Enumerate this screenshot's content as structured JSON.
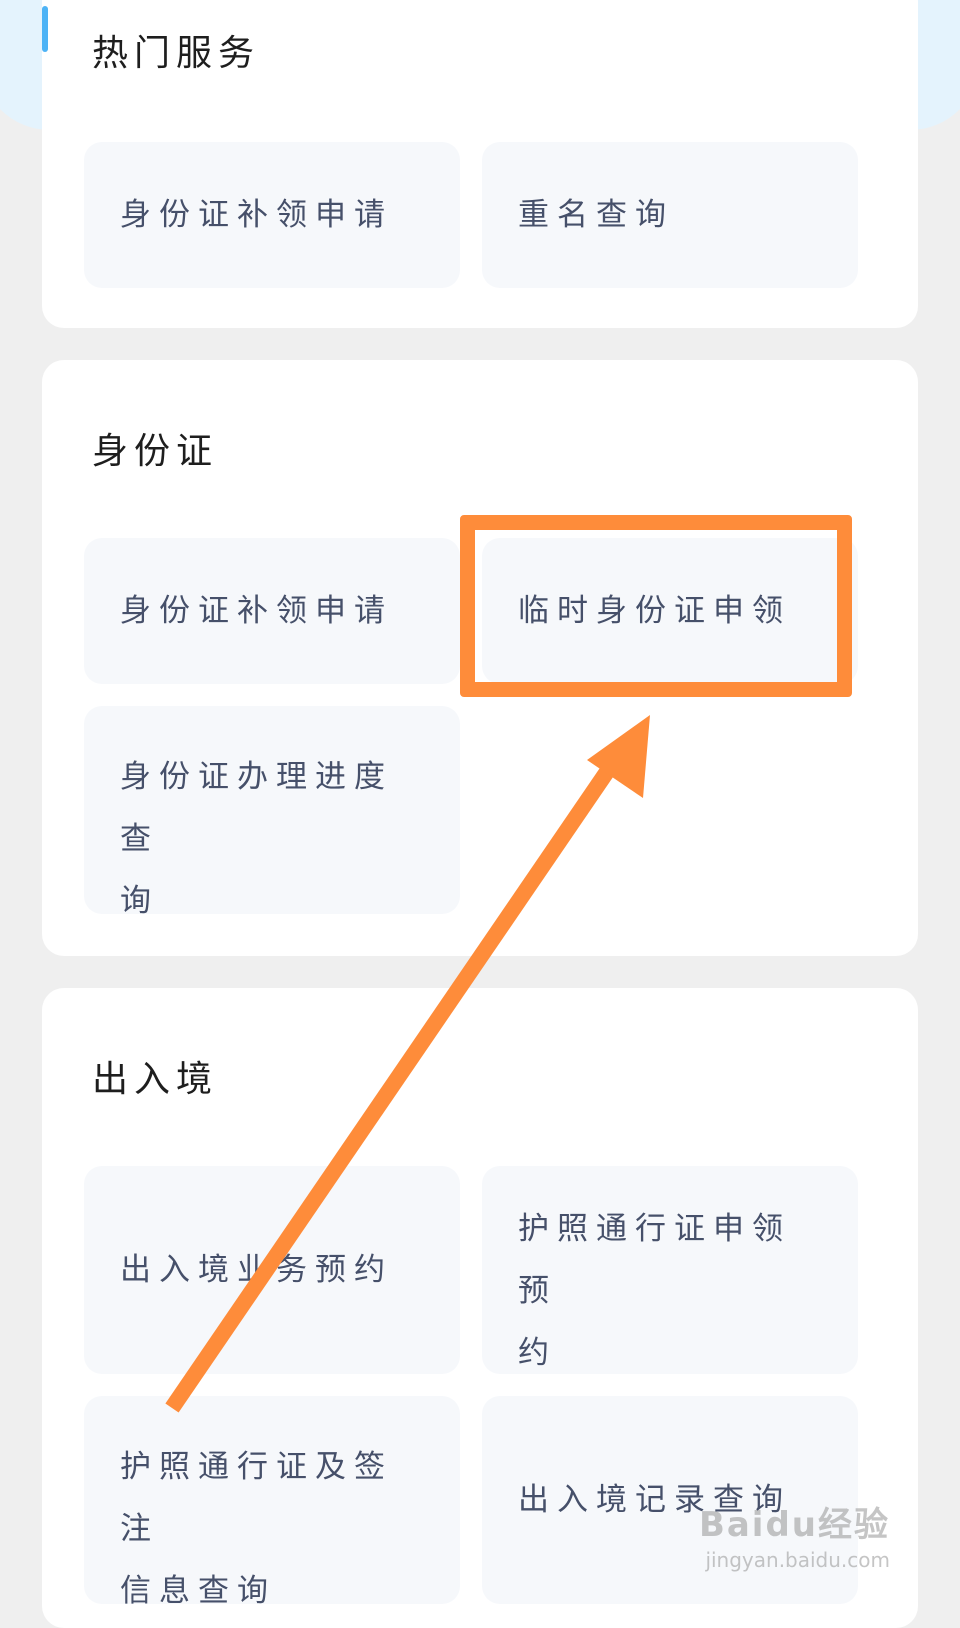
{
  "hot_services": {
    "title": "热门服务",
    "items": [
      {
        "label": "身份证补领申请"
      },
      {
        "label": "重名查询"
      }
    ]
  },
  "id_card": {
    "title": "身份证",
    "items": [
      {
        "label": "身份证补领申请"
      },
      {
        "label": "临时身份证申领"
      },
      {
        "line1": "身份证办理进度查",
        "line2": "询"
      }
    ]
  },
  "exit_entry": {
    "title": "出入境",
    "items": [
      {
        "label": "出入境业务预约"
      },
      {
        "line1": "护照通行证申领预",
        "line2": "约"
      },
      {
        "line1": "护照通行证及签注",
        "line2": "信息查询"
      },
      {
        "label": "出入境记录查询"
      }
    ]
  },
  "annotation": {
    "highlight_color": "#fe8c3a",
    "highlighted_item": "临时身份证申领"
  },
  "watermark": {
    "brand": "Baidu经验",
    "site": "jingyan.baidu.com"
  }
}
